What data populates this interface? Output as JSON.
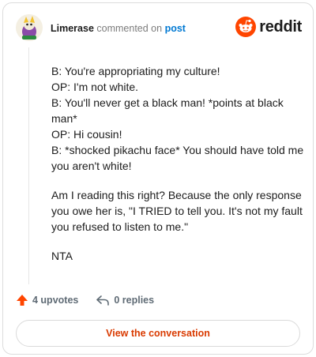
{
  "header": {
    "username": "Limerase",
    "action_text": "commented on",
    "post_link": "post",
    "brand_name": "reddit",
    "brand_color": "#ff4500"
  },
  "comment": {
    "lines": [
      "B: You're appropriating my culture!",
      "OP: I'm not white.",
      "B: You'll never get a black man! *points at black man*",
      "OP: Hi cousin!",
      "B: *shocked pikachu face* You should have told me you aren't white!"
    ],
    "paragraph2": "Am I reading this right? Because the only response you owe her is, \"I TRIED to tell you. It's not my fault you refused to listen to me.\"",
    "paragraph3": "NTA"
  },
  "actions": {
    "upvotes": "4 upvotes",
    "replies": "0 replies",
    "upvote_icon": "upvote-arrow-icon",
    "reply_icon": "reply-arrow-icon"
  },
  "cta": {
    "label": "View the conversation"
  },
  "colors": {
    "accent": "#d93a00",
    "link": "#0079d3"
  }
}
